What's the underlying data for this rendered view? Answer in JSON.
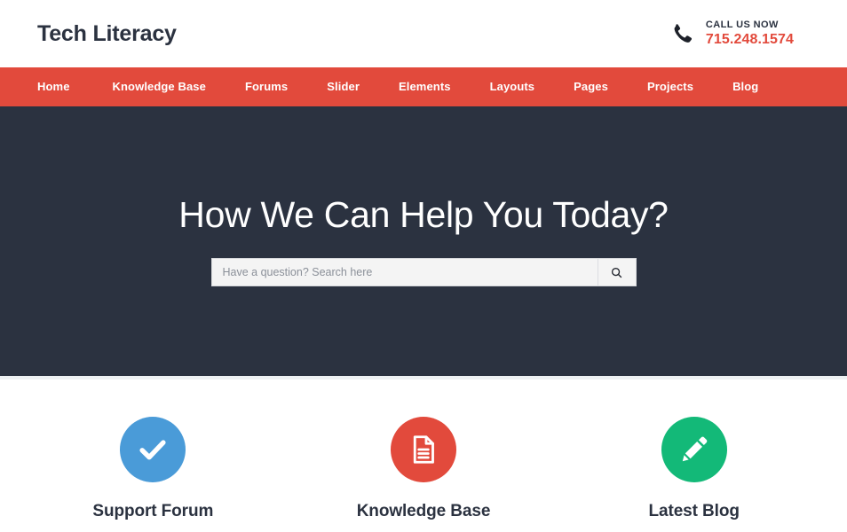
{
  "header": {
    "logo": "Tech Literacy",
    "call_label": "CALL US NOW",
    "phone": "715.248.1574",
    "phone_icon": "phone-icon"
  },
  "nav": {
    "items": [
      {
        "label": "Home",
        "active": true
      },
      {
        "label": "Knowledge Base",
        "active": false
      },
      {
        "label": "Forums",
        "active": false
      },
      {
        "label": "Slider",
        "active": false
      },
      {
        "label": "Elements",
        "active": false
      },
      {
        "label": "Layouts",
        "active": false
      },
      {
        "label": "Pages",
        "active": false
      },
      {
        "label": "Projects",
        "active": false
      },
      {
        "label": "Blog",
        "active": false
      }
    ]
  },
  "hero": {
    "title": "How We Can Help You Today?",
    "search_placeholder": "Have a question? Search here",
    "search_value": "",
    "search_icon": "search-icon"
  },
  "features": [
    {
      "icon": "check-circle-icon",
      "title": "Support Forum",
      "color": "#4a9bd8"
    },
    {
      "icon": "document-icon",
      "title": "Knowledge Base",
      "color": "#e24a3c"
    },
    {
      "icon": "pencil-icon",
      "title": "Latest Blog",
      "color": "#13b978"
    }
  ],
  "colors": {
    "accent_red": "#e24a3c",
    "hero_dark": "#2b3240",
    "feature_blue": "#4a9bd8",
    "feature_red": "#e24a3c",
    "feature_green": "#13b978",
    "page_bg": "#ffffff"
  }
}
